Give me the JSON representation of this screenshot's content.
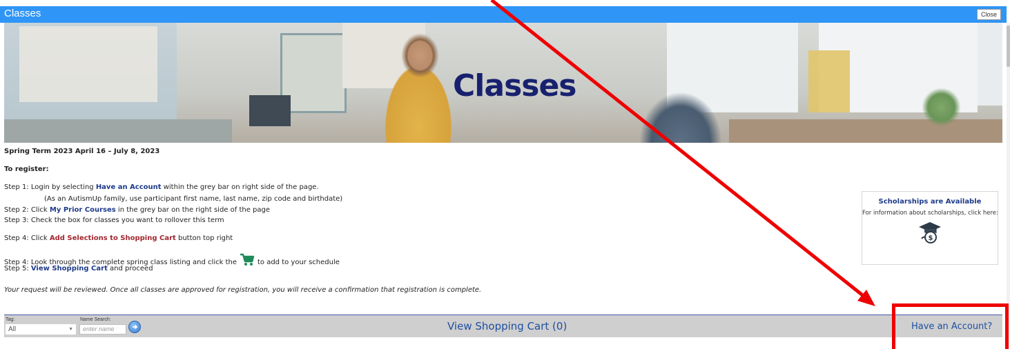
{
  "window": {
    "title": "Classes",
    "close_label": "Close"
  },
  "banner": {
    "title": "Classes"
  },
  "content": {
    "term": "Spring Term 2023 April 16 – July 8, 2023",
    "register_heading": "To register:",
    "step1_prefix": "Step 1: Login by selecting ",
    "step1_link": "Have an Account",
    "step1_suffix": " within the grey bar on right side of the page.",
    "step1_note": "(As an AutismUp family, use participant first name, last name, zip code and birthdate)",
    "step2_prefix": "Step 2: Click ",
    "step2_link": "My Prior Courses",
    "step2_suffix": " in the grey bar on the right side of the page",
    "step3": "Step 3: Check the box for classes you want to rollover this term",
    "step4a_prefix": "Step 4: Click ",
    "step4a_link": "Add Selections to Shopping Cart",
    "step4a_suffix": " button top right",
    "step4b_prefix": "Step 4: Look through the complete spring class listing and click the",
    "step4b_suffix": "to add to your schedule",
    "step5_prefix": "Step 5: ",
    "step5_link": "View Shopping Cart",
    "step5_suffix": " and proceed",
    "review_note": "Your request will be reviewed. Once all classes are approved for registration, you will receive a confirmation that registration is complete."
  },
  "scholarships": {
    "title": "Scholarships are Available",
    "text": "For information about scholarships, click here:",
    "icon": "graduation-cap-money-icon"
  },
  "toolbar": {
    "tag_label": "Tag:",
    "tag_value": "All",
    "name_label": "Name Search:",
    "name_placeholder": "enter name",
    "view_cart": "View Shopping Cart (0)",
    "have_account": "Have an Account?"
  },
  "annotation": {
    "color": "#ee0000",
    "target": "Have an Account?"
  },
  "colors": {
    "titlebar": "#2f95f6",
    "link_blue": "#1d3a8a",
    "link_red": "#a1272e",
    "banner_title": "#18216e",
    "toolbar_bg": "#cfcfcf"
  }
}
